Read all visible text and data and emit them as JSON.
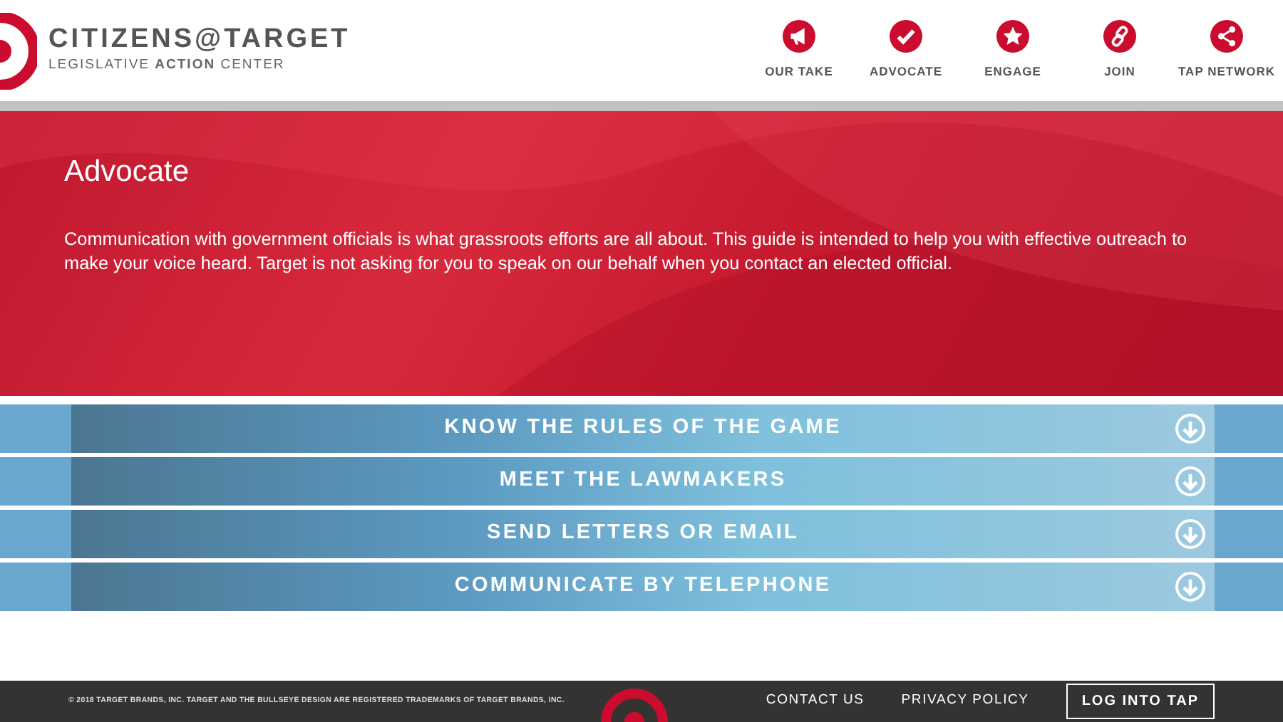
{
  "header": {
    "brand": "CITIZENS@TARGET",
    "tagline": "LEGISLATIVE **ACTION** CENTER",
    "nav": [
      {
        "label": "OUR TAKE"
      },
      {
        "label": "ADVOCATE"
      },
      {
        "label": "ENGAGE"
      },
      {
        "label": "JOIN"
      },
      {
        "label": "TAP NETWORK"
      }
    ]
  },
  "hero": {
    "title": "Advocate",
    "text": "Communication with government officials is what grassroots efforts are all about. This guide is intended to help you with effective outreach to make your voice heard. Target is not asking for you to speak on our behalf when you contact an elected official."
  },
  "sections": [
    {
      "label": "KNOW THE RULES OF THE GAME",
      "expanded": false
    },
    {
      "label": "MEET THE LAWMAKERS",
      "expanded": false
    },
    {
      "label": "SEND LETTERS OR EMAIL",
      "expanded": false
    },
    {
      "label": "COMMUNICATE BY TELEPHONE",
      "expanded": false
    }
  ],
  "footer": {
    "copyright": "© 2018 TARGET BRANDS, INC. TARGET AND THE BULLSEYE DESIGN ARE REGISTERED TRADEMARKS OF TARGET BRANDS, INC.",
    "links": [
      "CONTACT US",
      "PRIVACY POLICY"
    ],
    "button": "LOG INTO TAP"
  }
}
